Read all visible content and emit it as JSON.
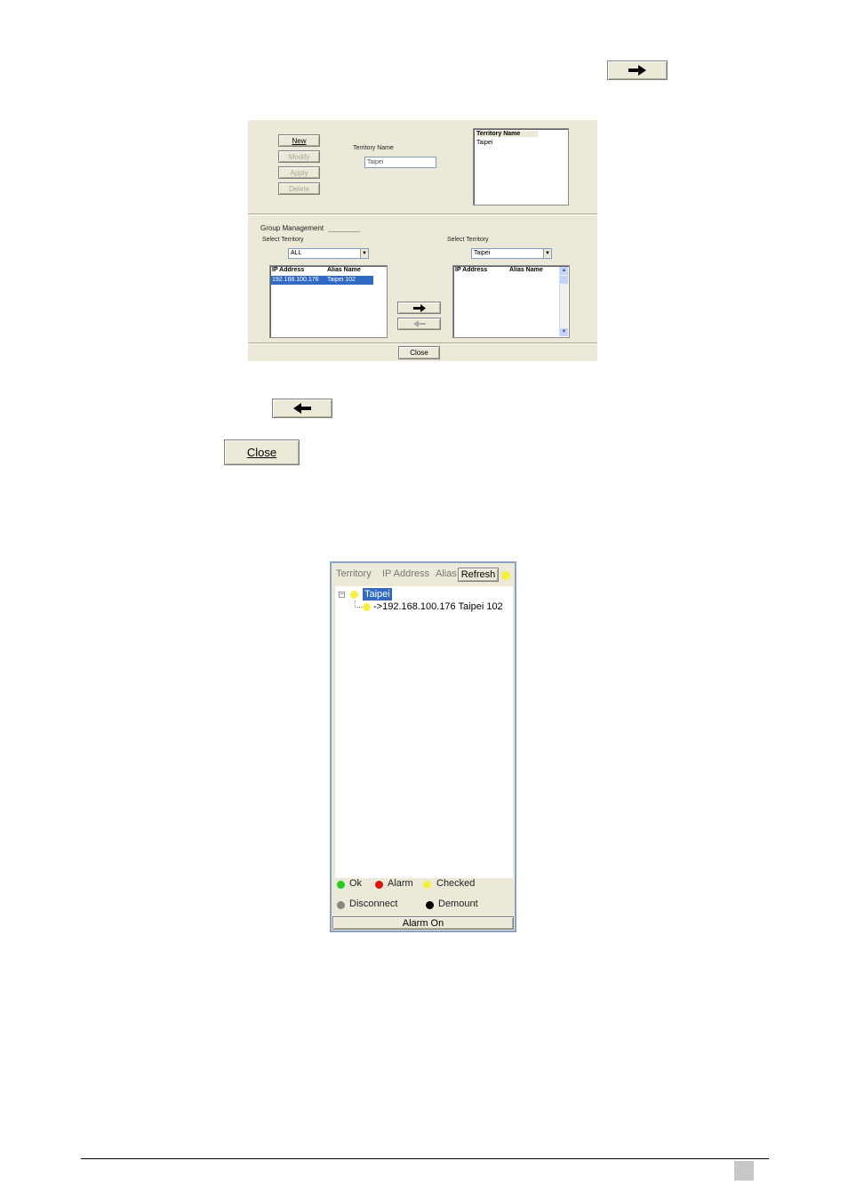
{
  "top_add_button": {
    "icon": "right-arrow-icon"
  },
  "dialog": {
    "buttons": {
      "new": "New",
      "modify": "Modify",
      "apply": "Apply",
      "delete": "Delete"
    },
    "territory_name_label": "Territory Name",
    "territory_name_value": "Taipei",
    "territory_list": {
      "header": "Territory Name",
      "items": [
        "Taipei"
      ]
    },
    "group_management_label": "Group Management",
    "left": {
      "select_label": "Select Territory",
      "select_value": "ALL",
      "columns": [
        "IP Address",
        "Alias Name"
      ],
      "rows": [
        {
          "ip": "192.168.100.176",
          "alias": "Taipei 102"
        }
      ]
    },
    "right": {
      "select_label": "Select Territory",
      "select_value": "Taipei",
      "columns": [
        "IP Address",
        "Alias Name"
      ]
    },
    "close_label": "Close"
  },
  "standalone_close_label": "Close",
  "monitor": {
    "tabs": [
      "Territory",
      "IP Address",
      "Alias"
    ],
    "refresh_label": "Refresh",
    "tree": {
      "root_label": "Taipei",
      "child_label": "->192.168.100.176 Taipei 102"
    },
    "legend": [
      {
        "label": "Ok",
        "color": "#22cc22"
      },
      {
        "label": "Alarm",
        "color": "#dd1111"
      },
      {
        "label": "Checked",
        "color": "#f5f040"
      },
      {
        "label": "Disconnect",
        "color": "#888888"
      },
      {
        "label": "Demount",
        "color": "#000000"
      }
    ],
    "alarm_button_label": "Alarm On"
  }
}
